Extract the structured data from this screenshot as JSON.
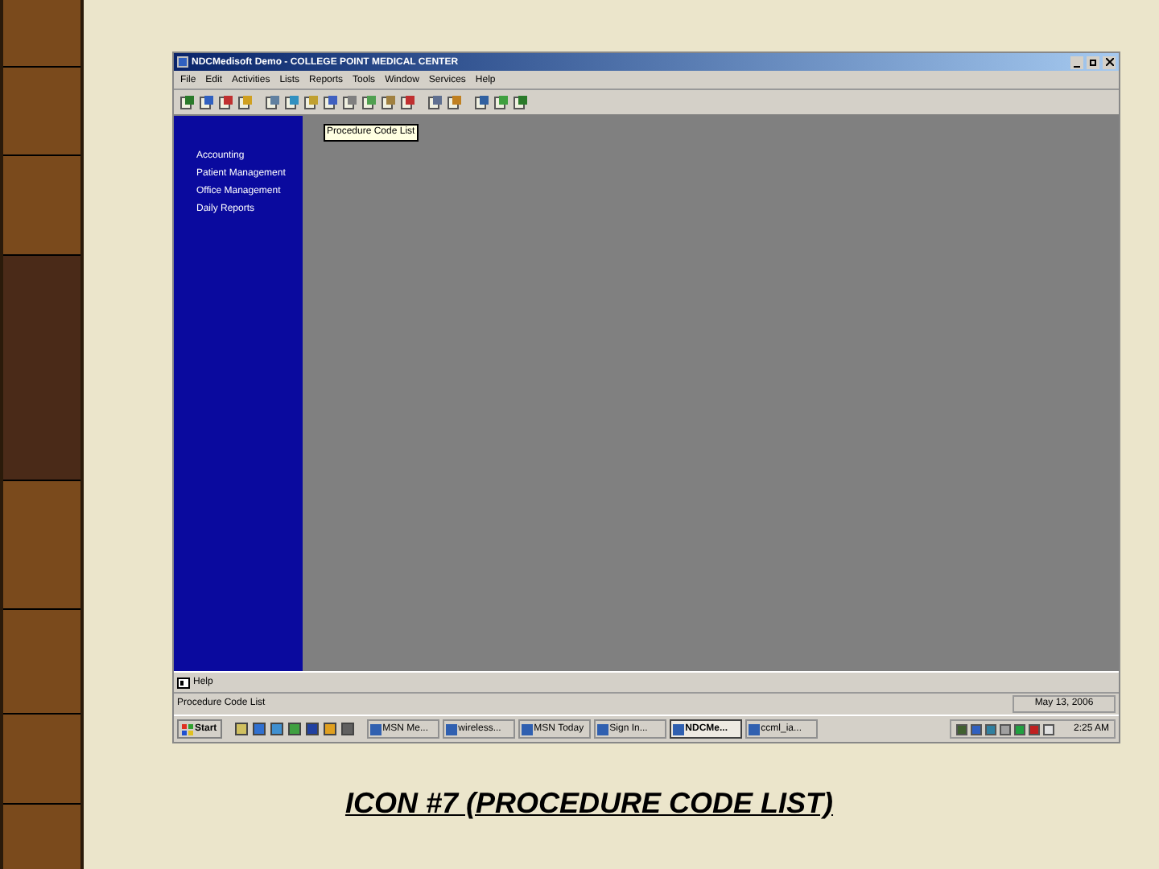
{
  "window": {
    "title": "NDCMedisoft Demo - COLLEGE POINT MEDICAL CENTER"
  },
  "menu": [
    "File",
    "Edit",
    "Activities",
    "Lists",
    "Reports",
    "Tools",
    "Window",
    "Services",
    "Help"
  ],
  "tooltip": "Procedure Code List",
  "sidebar": {
    "items": [
      {
        "label": "Accounting"
      },
      {
        "label": "Patient Management"
      },
      {
        "label": "Office Management"
      },
      {
        "label": "Daily Reports"
      }
    ]
  },
  "help_bar": {
    "label": "Help"
  },
  "status_bar": {
    "message": "Procedure Code List",
    "date": "May 13, 2006"
  },
  "taskbar": {
    "start": "Start",
    "tasks": [
      {
        "label": "MSN Me...",
        "selected": false
      },
      {
        "label": "wireless...",
        "selected": false
      },
      {
        "label": "MSN Today",
        "selected": false
      },
      {
        "label": "Sign In...",
        "selected": false
      },
      {
        "label": "NDCMe...",
        "selected": true
      },
      {
        "label": "ccml_ia...",
        "selected": false
      }
    ],
    "clock": "2:25 AM"
  },
  "caption": "ICON #7 (PROCEDURE CODE LIST)"
}
